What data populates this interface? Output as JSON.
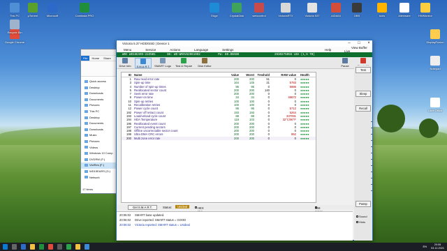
{
  "desktop_icons": [
    {
      "label": "This PC",
      "color": "#4f8fd6"
    },
    {
      "label": "μTorrent",
      "color": "#5aa02c"
    },
    {
      "label": "Microsoft",
      "color": "#2d69c8"
    },
    {
      "label": "Camtasia PRO",
      "color": "#1f8f3c"
    },
    {
      "label": "Google Chrome",
      "color": "#e04b3a"
    },
    {
      "label": "Recycle Bin",
      "color": "#9fb4cc"
    },
    {
      "label": "Edge",
      "color": "#1d8bd6"
    },
    {
      "label": "CrystalDisk",
      "color": "#3fa35c"
    },
    {
      "label": "webcontrol",
      "color": "#c74b4b"
    },
    {
      "label": "VictoriaRTX",
      "color": "#d8d8d8"
    },
    {
      "label": "Victoria 537",
      "color": "#e3e3e3"
    },
    {
      "label": "AIDA64",
      "color": "#d24d3a"
    },
    {
      "label": "OBS",
      "color": "#3a3a3a"
    },
    {
      "label": "tools",
      "color": "#ffb400"
    },
    {
      "label": "Alienware",
      "color": "#ffffff"
    },
    {
      "label": "HWMonitor",
      "color": "#ffcf3f"
    },
    {
      "label": "DisplayFusion",
      "color": "#ffcc4d"
    },
    {
      "label": "Notepad",
      "color": "#eeeeee"
    },
    {
      "label": "Libre Office",
      "color": "#ffffff"
    }
  ],
  "explorer": {
    "tabs": [
      "File",
      "Home",
      "Share"
    ],
    "nav": [
      {
        "label": "Quick access"
      },
      {
        "label": "Desktop"
      },
      {
        "label": "Downloads"
      },
      {
        "label": "Documents"
      },
      {
        "label": "Pictures"
      },
      {
        "label": "This PC"
      },
      {
        "label": "Desktop"
      },
      {
        "label": "Documents"
      },
      {
        "label": "Downloads"
      },
      {
        "label": "Music"
      },
      {
        "label": "Pictures"
      },
      {
        "label": "Videos"
      },
      {
        "label": "Windows 10 Comp"
      },
      {
        "label": "DVDRW (F:)"
      },
      {
        "label": "VictRes (F:)"
      },
      {
        "label": "WD15EARS (G:)"
      },
      {
        "label": "Network"
      }
    ],
    "status": "17 items"
  },
  "victoria": {
    "title": "Victoria 5.37 HDD/SSD | Device 1",
    "menu": [
      "Menu",
      "Service",
      "Actions",
      "Language",
      "Settings"
    ],
    "help": "Help",
    "view_buffer": "View Buffer Live",
    "device_bar": {
      "model": "WDC WD15EARS-22Z5B1",
      "serial": "SN: WD-WMAVU2961992",
      "fw": "FW: 80.00A80",
      "lba": "2930275055 LBA (1,5 TB)"
    },
    "toolbar": [
      "Drive Info",
      "S.M.A.R.T.",
      "SMART Logs",
      "Test & Repair",
      "Disk Editor"
    ],
    "pause": "Pause",
    "break_all": "Break All",
    "table_headers": {
      "id": "ID",
      "name": "Name",
      "value": "Value",
      "worst": "Worst",
      "thresh": "Treshold",
      "raw": "RAW value",
      "health": "Health"
    },
    "smart": [
      {
        "id": "1",
        "name": "Raw read error rate",
        "value": "200",
        "worst": "200",
        "thresh": "51",
        "raw": "0",
        "health": "●●●●●"
      },
      {
        "id": "3",
        "name": "Spin-up time",
        "value": "164",
        "worst": "145",
        "thresh": "21",
        "raw": "5783",
        "health": "●●●●●"
      },
      {
        "id": "4",
        "name": "Number of spin-up times",
        "value": "95",
        "worst": "95",
        "thresh": "0",
        "raw": "5986",
        "health": "●●●●●"
      },
      {
        "id": "5",
        "name": "Reallocated sector count",
        "value": "200",
        "worst": "200",
        "thresh": "140",
        "raw": "0",
        "health": "●●●●●"
      },
      {
        "id": "7",
        "name": "Seek error rate",
        "value": "200",
        "worst": "200",
        "thresh": "0",
        "raw": "0",
        "health": "●●●●●"
      },
      {
        "id": "9",
        "name": "Power-on time",
        "value": "34",
        "worst": "34",
        "thresh": "0",
        "raw": "48872",
        "health": "●●●●●"
      },
      {
        "id": "10",
        "name": "Spin-up retries",
        "value": "100",
        "worst": "100",
        "thresh": "0",
        "raw": "0",
        "health": "●●●●●"
      },
      {
        "id": "11",
        "name": "Recalibration retries",
        "value": "100",
        "worst": "100",
        "thresh": "0",
        "raw": "0",
        "health": "●●●●●"
      },
      {
        "id": "12",
        "name": "Power cycle count",
        "value": "95",
        "worst": "95",
        "thresh": "0",
        "raw": "5712",
        "health": "●●●●●"
      },
      {
        "id": "192",
        "name": "Power off retract count",
        "value": "193",
        "worst": "193",
        "thresh": "0",
        "raw": "5264",
        "health": "●●●●●"
      },
      {
        "id": "193",
        "name": "Load/unload cycle count",
        "value": "88",
        "worst": "88",
        "thresh": "0",
        "raw": "337091",
        "health": "●●●●●"
      },
      {
        "id": "194",
        "name": "HDA Temperature",
        "value": "118",
        "worst": "103",
        "thresh": "0",
        "raw": "32°C/90°F",
        "health": "●●●●●"
      },
      {
        "id": "196",
        "name": "Reallocated event count",
        "value": "200",
        "worst": "200",
        "thresh": "0",
        "raw": "0",
        "health": "●●●●●"
      },
      {
        "id": "197",
        "name": "Current pending sectors",
        "value": "200",
        "worst": "200",
        "thresh": "0",
        "raw": "0",
        "health": "●●●●●"
      },
      {
        "id": "198",
        "name": "Offline uncorrectable sector count",
        "value": "200",
        "worst": "200",
        "thresh": "0",
        "raw": "0",
        "health": "●●●●●"
      },
      {
        "id": "199",
        "name": "Ultra DMA CRC errors",
        "value": "200",
        "worst": "200",
        "thresh": "0",
        "raw": "952",
        "health": "●●●●●"
      },
      {
        "id": "200",
        "name": "Multi zone error rate",
        "value": "200",
        "worst": "200",
        "thresh": "0",
        "raw": "0",
        "health": "●●●●●"
      }
    ],
    "right_panel": {
      "test": "Test",
      "sleep": "Sleep",
      "recall": "Recall",
      "passp": "Passp",
      "sound": "Sound",
      "hints": "Hints"
    },
    "bottom_bar": {
      "get_smart": "Get S.M.A.R.T.",
      "status_label": "Status:",
      "status_value": "Unideal",
      "hex_raw": "HEX raw values",
      "ibm": "IBM super smart"
    },
    "log": [
      {
        "time": "20:06:02",
        "msg": "SMART base updated."
      },
      {
        "time": "20:06:02",
        "msg": "Drive reported: SMART status = GOOD"
      },
      {
        "time": "20:06:02",
        "msg": "Victoria reported: SMART status = Unideal"
      }
    ]
  },
  "taskbar": {
    "lang": "EN",
    "time": "20:06",
    "date": "03.12.2021"
  },
  "colors": {
    "green_bar": "#0e6e2e",
    "attr_name": "#3c2380",
    "attr_value": "#0b6a24",
    "status_badge": "#b8860b"
  }
}
